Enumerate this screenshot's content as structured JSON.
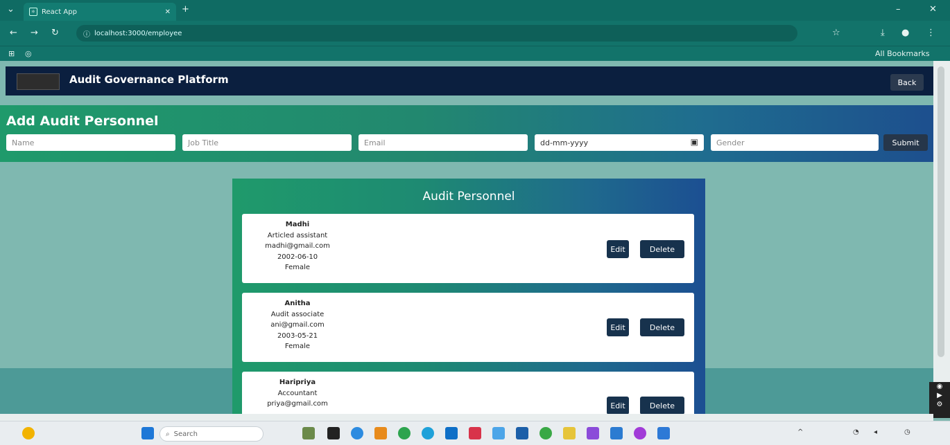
{
  "browser": {
    "tab_title": "React App",
    "address": "localhost:3000/employee",
    "all_bookmarks": "All Bookmarks"
  },
  "header": {
    "title": "Audit Governance Platform",
    "back_label": "Back"
  },
  "form": {
    "title": "Add Audit Personnel",
    "name_placeholder": "Name",
    "job_title_placeholder": "Job Title",
    "email_placeholder": "Email",
    "date_placeholder": "dd-mm-yyyy",
    "gender_placeholder": "Gender",
    "submit_label": "Submit"
  },
  "list": {
    "title": "Audit Personnel",
    "edit_label": "Edit",
    "delete_label": "Delete",
    "items": [
      {
        "name": "Madhi",
        "job": "Articled assistant",
        "email": "madhi@gmail.com",
        "dob": "2002-06-10",
        "gender": "Female"
      },
      {
        "name": "Anitha",
        "job": "Audit associate",
        "email": "ani@gmail.com",
        "dob": "2003-05-21",
        "gender": "Female"
      },
      {
        "name": "Haripriya",
        "job": "Accountant",
        "email": "priya@gmail.com",
        "dob": "",
        "gender": ""
      }
    ]
  },
  "taskbar": {
    "search_placeholder": "Search"
  }
}
